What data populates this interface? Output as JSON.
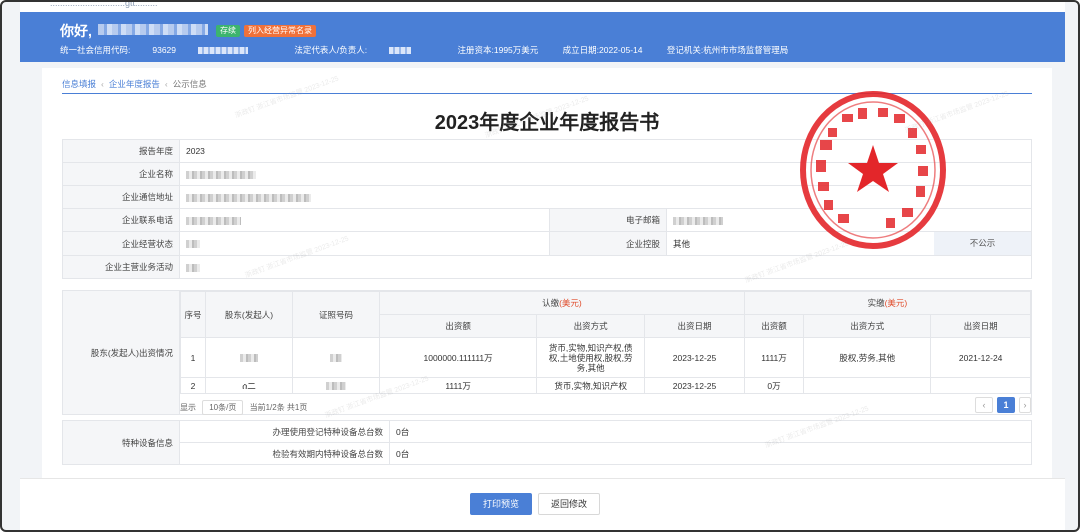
{
  "top_bar": {
    "url_text": "..............................gtt........."
  },
  "header": {
    "greeting": "你好,",
    "badges": [
      "存续",
      "列入经营异常名录"
    ],
    "credit_code_label": "统一社会信用代码:",
    "credit_code_value": "93629",
    "legal_rep_label": "法定代表人/负责人:",
    "registered_capital": "注册资本:1995万美元",
    "established": "成立日期:2022-05-14",
    "authority": "登记机关:杭州市市场监督管理局"
  },
  "breadcrumb": {
    "items": [
      "信息填报",
      "企业年度报告",
      "公示信息"
    ]
  },
  "title": "2023年度企业年度报告书",
  "basic": {
    "year_label": "报告年度",
    "year_value": "2023",
    "name_label": "企业名称",
    "address_label": "企业通信地址",
    "phone_label": "企业联系电话",
    "email_label": "电子邮箱",
    "status_label": "企业经营状态",
    "holding_label": "企业控股",
    "holding_value": "其他",
    "holding_public": "不公示",
    "main_business_label": "企业主营业务活动"
  },
  "shareholders": {
    "section_label": "股东(发起人)出资情况",
    "headers": {
      "index": "序号",
      "holder": "股东(发起人)",
      "id": "证照号码",
      "subscribed": "认缴",
      "paid": "实缴",
      "unit": "(美元)",
      "amount": "出资额",
      "method": "出资方式",
      "date": "出资日期"
    },
    "rows": [
      {
        "index": "1",
        "sub_amount": "1000000.111111万",
        "sub_method": "货币,实物,知识产权,债权,土地使用权,股权,劳务,其他",
        "sub_date": "2023-12-25",
        "paid_amount": "1111万",
        "paid_method": "股权,劳务,其他",
        "paid_date": "2021-12-24"
      },
      {
        "index": "2",
        "holder_partial": "ሰ⼆",
        "sub_amount": "1111万",
        "sub_method": "货币,实物,知识产权",
        "sub_date": "2023-12-25",
        "paid_amount": "0万",
        "paid_method": "",
        "paid_date": ""
      }
    ],
    "pager": {
      "show": "显示",
      "per_page": "10条/页",
      "current": "当前1/2条 共1页",
      "page": "1",
      "prev": "‹",
      "next": "›"
    }
  },
  "equipment": {
    "section_label": "特种设备信息",
    "rows": [
      {
        "label": "办理使用登记特种设备总台数",
        "value": "0台"
      },
      {
        "label": "检验有效期内特种设备总台数",
        "value": "0台"
      }
    ]
  },
  "actions": {
    "print": "打印预览",
    "back": "返回修改"
  },
  "watermark_text": "浙政钉 浙江省市场监管 2023-12-25"
}
